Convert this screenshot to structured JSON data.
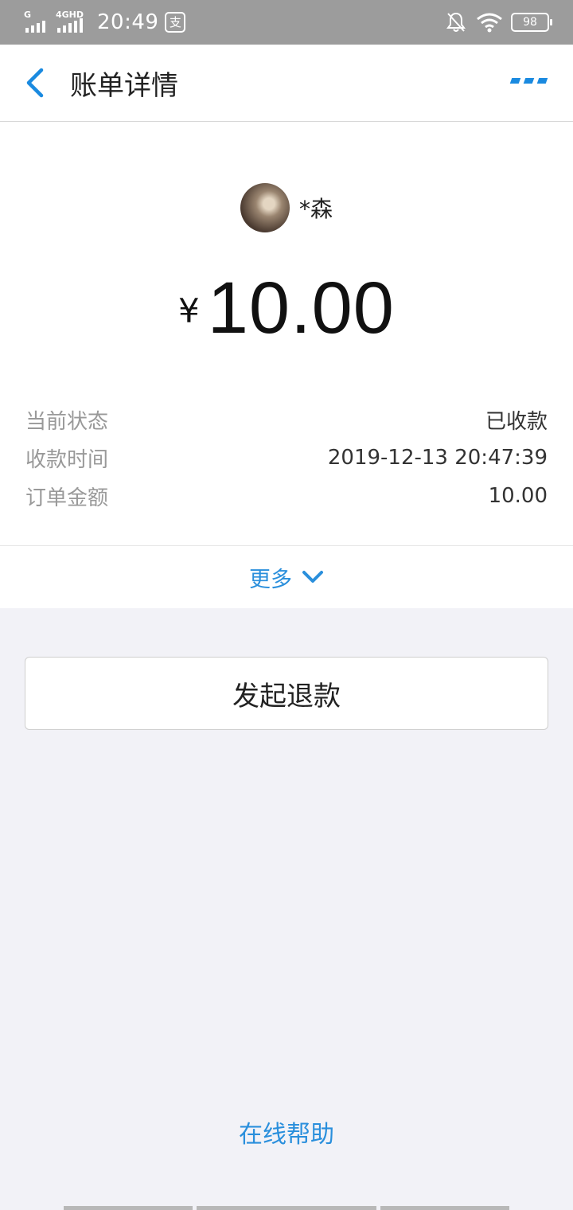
{
  "status_bar": {
    "sim1_label": "G",
    "sim2_label": "4GHD",
    "time": "20:49",
    "app_icon": "支",
    "battery": "98"
  },
  "nav": {
    "title": "账单详情"
  },
  "payer": {
    "name": "*森"
  },
  "amount": {
    "currency": "¥",
    "value": "10.00"
  },
  "details": [
    {
      "label": "当前状态",
      "value": "已收款"
    },
    {
      "label": "收款时间",
      "value": "2019-12-13 20:47:39"
    },
    {
      "label": "订单金额",
      "value": "10.00"
    }
  ],
  "more_label": "更多",
  "refund_label": "发起退款",
  "help_label": "在线帮助",
  "colors": {
    "accent": "#2a8fdc",
    "status_bar": "#9c9c9c",
    "background": "#f2f2f7"
  }
}
